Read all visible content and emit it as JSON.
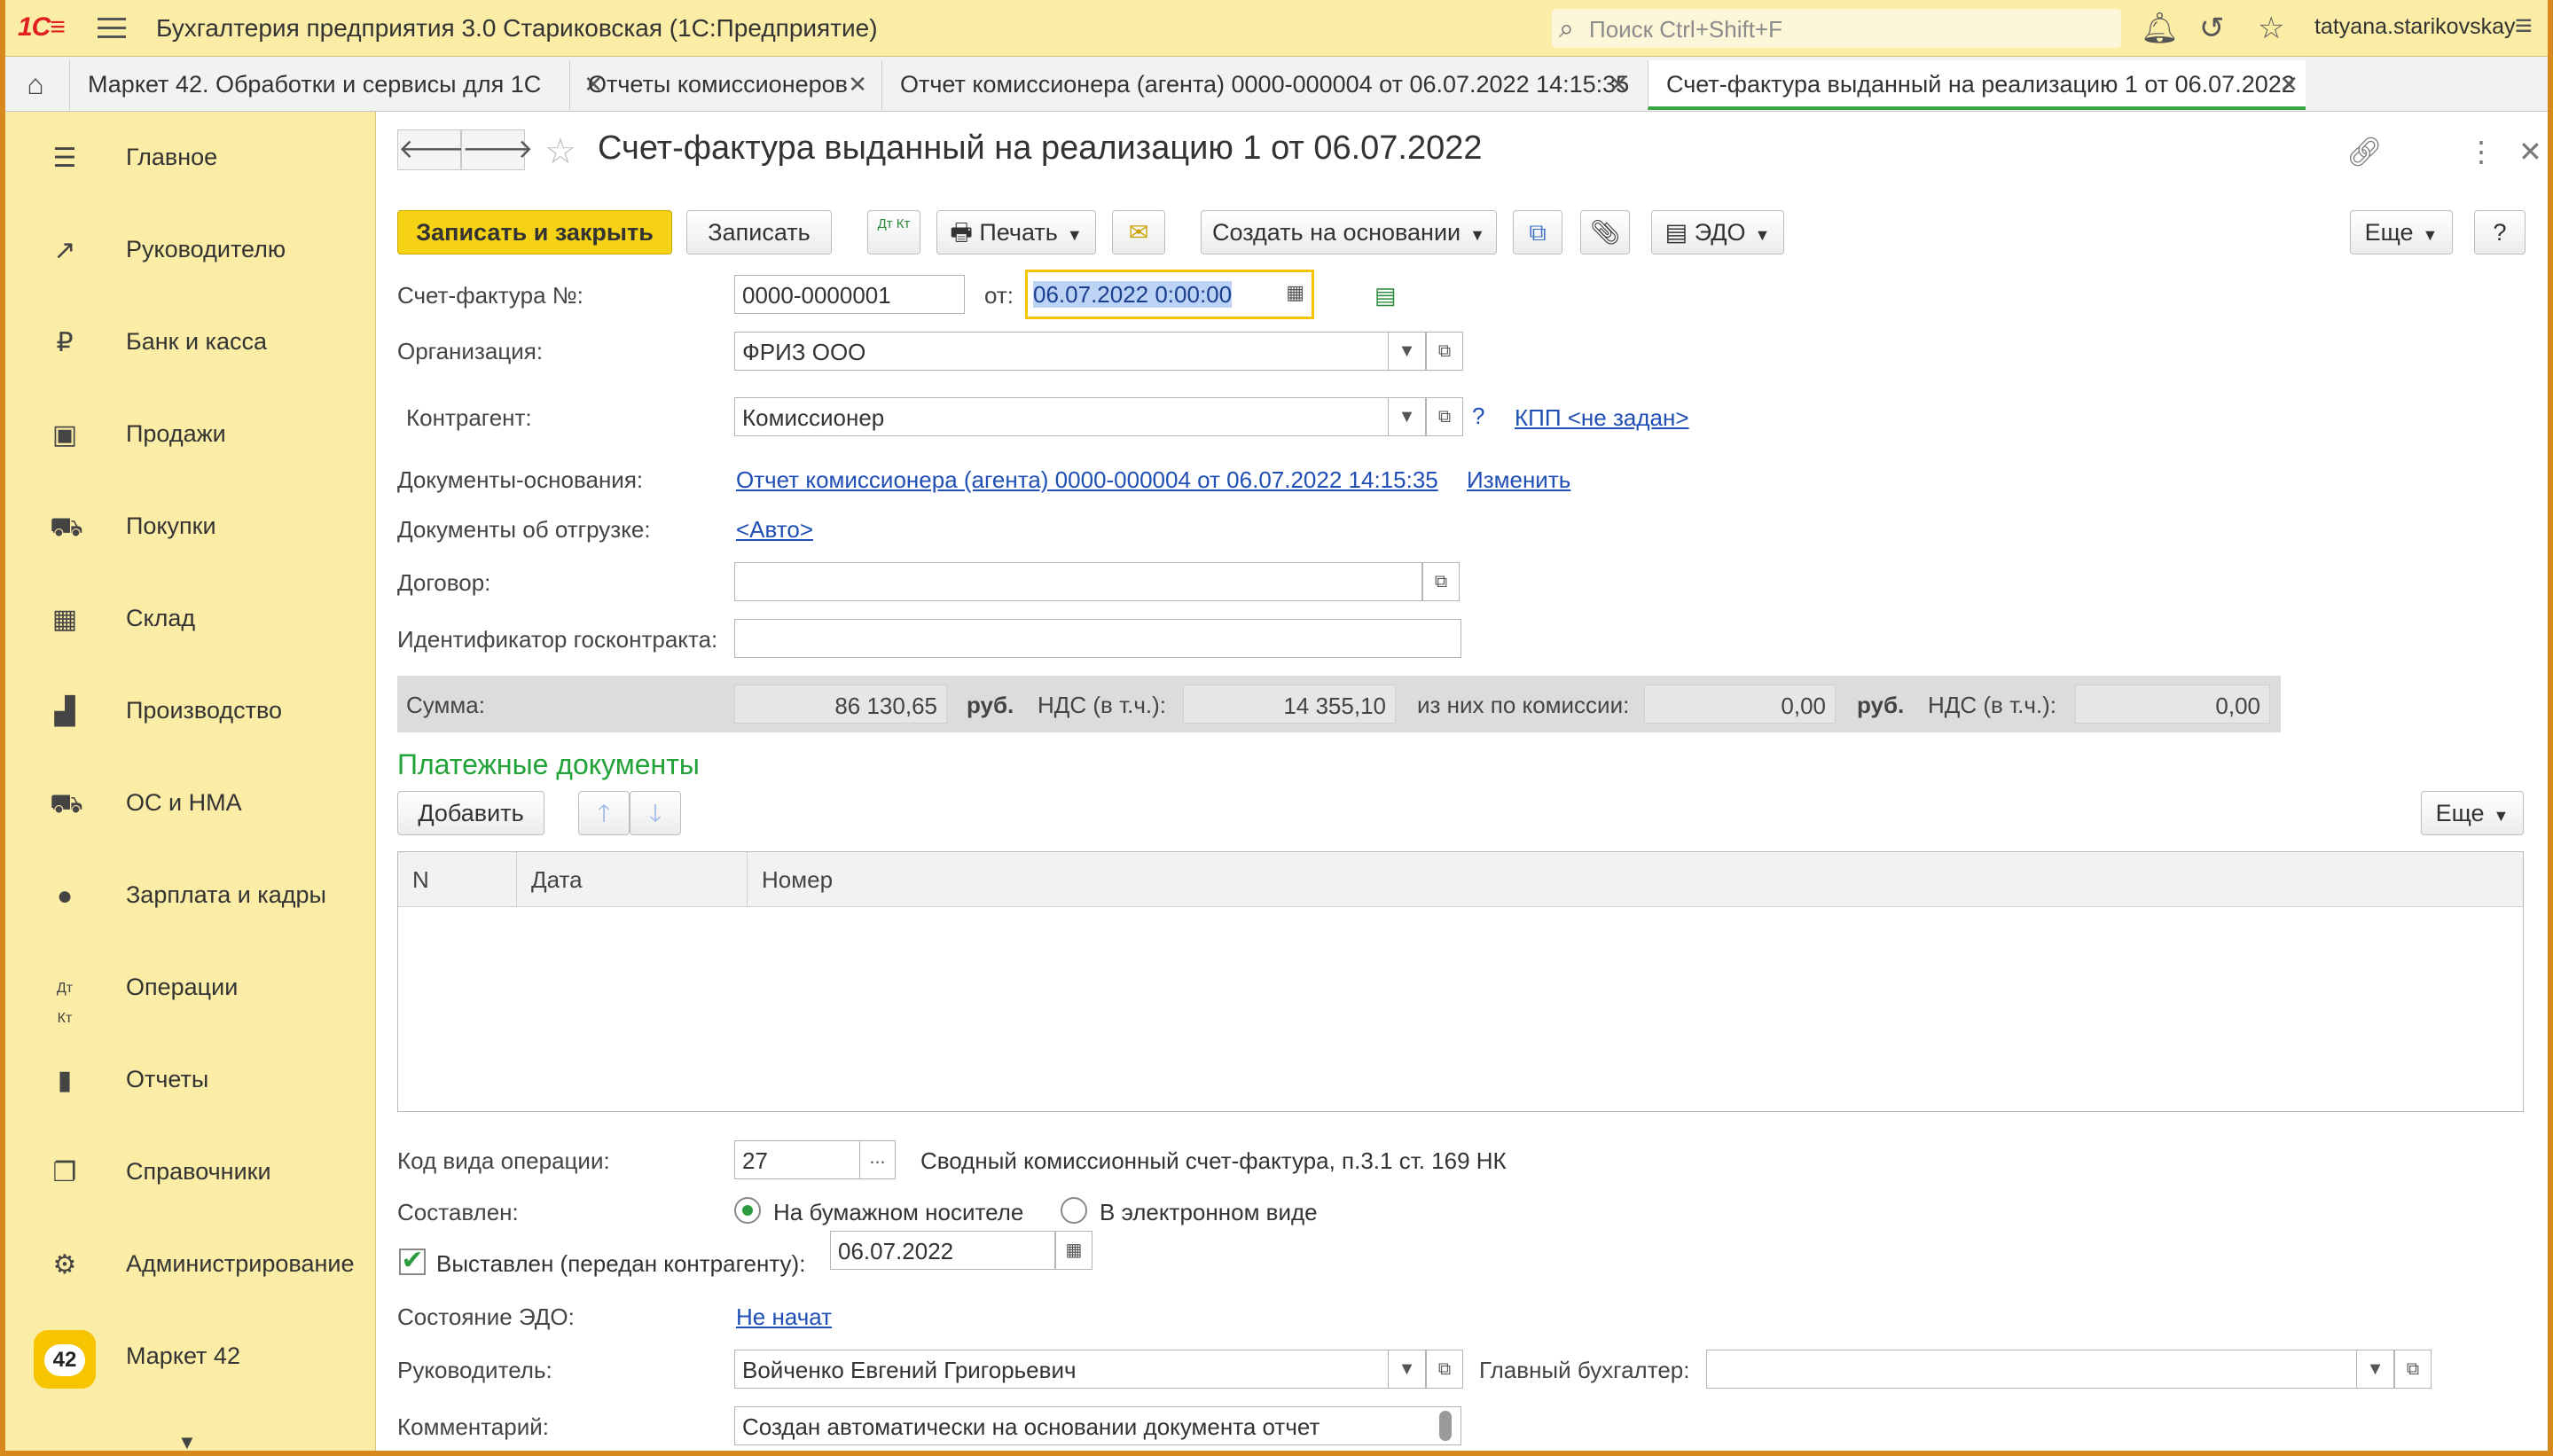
{
  "app": {
    "logo": "1С",
    "title": "Бухгалтерия предприятия 3.0 Стариковская  (1С:Предприятие)",
    "search_placeholder": "Поиск Ctrl+Shift+F",
    "user": "tatyana.starikovskay"
  },
  "tabs": [
    {
      "label": "Маркет 42. Обработки и сервисы для 1С"
    },
    {
      "label": "Отчеты комиссионеров"
    },
    {
      "label": "Отчет комиссионера (агента) 0000-000004 от 06.07.2022 14:15:35"
    },
    {
      "label": "Счет-фактура выданный на реализацию 1 от 06.07.2022"
    }
  ],
  "sidebar": {
    "items": [
      {
        "label": "Главное",
        "icon": "list-icon"
      },
      {
        "label": "Руководителю",
        "icon": "trend-icon"
      },
      {
        "label": "Банк и касса",
        "icon": "ruble-icon"
      },
      {
        "label": "Продажи",
        "icon": "bag-icon"
      },
      {
        "label": "Покупки",
        "icon": "cart-icon"
      },
      {
        "label": "Склад",
        "icon": "warehouse-icon"
      },
      {
        "label": "Производство",
        "icon": "factory-icon"
      },
      {
        "label": "ОС и НМА",
        "icon": "truck-icon"
      },
      {
        "label": "Зарплата и кадры",
        "icon": "person-icon"
      },
      {
        "label": "Операции",
        "icon": "dt-kt-icon"
      },
      {
        "label": "Отчеты",
        "icon": "bar-chart-icon"
      },
      {
        "label": "Справочники",
        "icon": "books-icon"
      },
      {
        "label": "Администрирование",
        "icon": "gear-icon"
      },
      {
        "label": "Маркет 42",
        "icon": "market42-icon"
      }
    ],
    "market_badge": "42"
  },
  "form": {
    "title": "Счет-фактура выданный на реализацию 1 от 06.07.2022",
    "toolbar": {
      "save_close": "Записать и закрыть",
      "save": "Записать",
      "dtkt": "Дт Кт",
      "print": "Печать",
      "create_based": "Создать на основании",
      "edo": "ЭДО",
      "more": "Еще",
      "help": "?"
    },
    "invoice_no_label": "Счет-фактура №:",
    "invoice_no": "0000-0000001",
    "date_label": "от:",
    "date": "06.07.2022  0:00:00",
    "org_label": "Организация:",
    "org": "ФРИЗ ООО",
    "contractor_label": "Контрагент:",
    "contractor": "Комиссионер",
    "question": "?",
    "kpp_link": "КПП <не задан>",
    "basis_label": "Документы-основания:",
    "basis_link": "Отчет комиссионера (агента) 0000-000004 от 06.07.2022 14:15:35",
    "change_link": "Изменить",
    "shipment_label": "Документы об отгрузке:",
    "shipment_link": "<Авто>",
    "contract_label": "Договор:",
    "contract": "",
    "gov_id_label": "Идентификатор госконтракта:",
    "gov_id": "",
    "totals": {
      "sum_label": "Сумма:",
      "sum": "86 130,65",
      "rub1": "руб.",
      "vat_label": "НДС (в т.ч.):",
      "vat": "14 355,10",
      "commission_label": "из них по комиссии:",
      "commission": "0,00",
      "rub2": "руб.",
      "vat2_label": "НДС (в т.ч.):",
      "vat2": "0,00"
    },
    "payments_title": "Платежные документы",
    "add_button": "Добавить",
    "table_more": "Еще",
    "table_columns": [
      "N",
      "Дата",
      "Номер"
    ],
    "op_code_label": "Код вида операции:",
    "op_code": "27",
    "op_code_btn": "...",
    "op_code_desc": "Сводный комиссионный счет-фактура, п.3.1 ст. 169 НК",
    "compiled_label": "Составлен:",
    "compiled_paper": "На бумажном носителе",
    "compiled_electronic": "В электронном виде",
    "issued_label": "Выставлен (передан контрагенту):",
    "issued_date": "06.07.2022",
    "edo_state_label": "Состояние ЭДО:",
    "edo_state_link": "Не начат",
    "head_label": "Руководитель:",
    "head": "Войченко Евгений Григорьевич",
    "chief_acc_label": "Главный бухгалтер:",
    "chief_acc": "",
    "comment_label": "Комментарий:",
    "comment": "Создан автоматически на основании документа отчет"
  }
}
